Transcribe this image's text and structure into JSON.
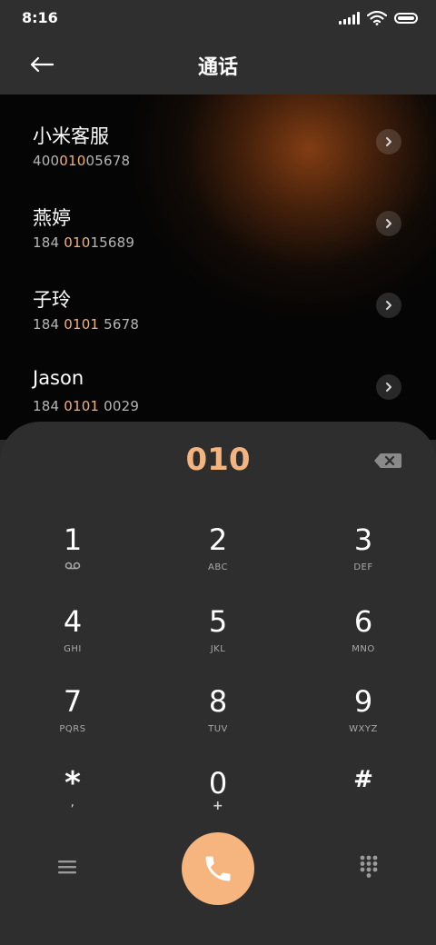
{
  "status_bar": {
    "time": "8:16"
  },
  "header": {
    "title": "通话"
  },
  "contacts": [
    {
      "name": "小米客服",
      "number_parts": [
        "400",
        "010",
        "05678"
      ]
    },
    {
      "name": "燕婷",
      "number_parts": [
        "184 ",
        "010",
        "15689"
      ]
    },
    {
      "name": "子玲",
      "number_parts": [
        "184 ",
        "0101",
        " 5678"
      ]
    },
    {
      "name": "Jason",
      "number_parts": [
        "184 ",
        "0101",
        " 0029"
      ]
    }
  ],
  "dial": {
    "input": "010"
  },
  "keys": [
    {
      "digit": "1",
      "letters": ""
    },
    {
      "digit": "2",
      "letters": "ABC"
    },
    {
      "digit": "3",
      "letters": "DEF"
    },
    {
      "digit": "4",
      "letters": "GHI"
    },
    {
      "digit": "5",
      "letters": "JKL"
    },
    {
      "digit": "6",
      "letters": "MNO"
    },
    {
      "digit": "7",
      "letters": "PQRS"
    },
    {
      "digit": "8",
      "letters": "TUV"
    },
    {
      "digit": "9",
      "letters": "WXYZ"
    },
    {
      "digit": "*",
      "letters": ","
    },
    {
      "digit": "0",
      "letters": "+"
    },
    {
      "digit": "#",
      "letters": ""
    }
  ],
  "icons": {
    "back": "arrow-left-icon",
    "voicemail": "voicemail-icon",
    "backspace": "backspace-icon",
    "menu": "menu-icon",
    "call": "phone-icon",
    "dialpad": "dialpad-icon"
  },
  "colors": {
    "accent": "#f3b47f",
    "call_button": "#f6b47e",
    "background": "#2e2e2e"
  }
}
